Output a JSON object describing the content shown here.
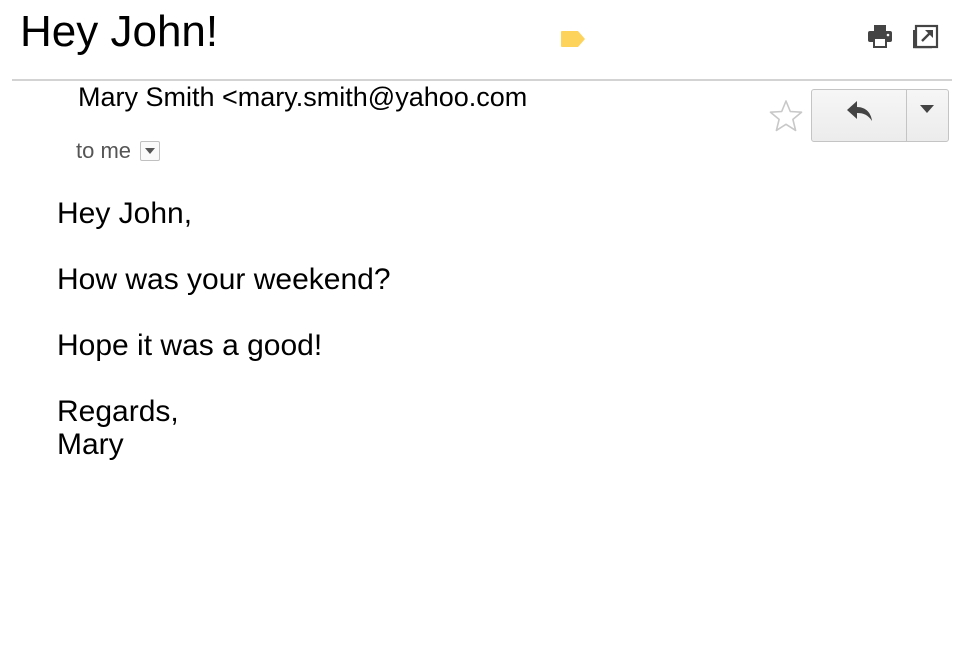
{
  "email": {
    "subject": "Hey John!",
    "sender": "Mary Smith <mary.smith@yahoo.com",
    "recipient": "to me",
    "body": {
      "greeting": "Hey John,",
      "line1": "How was your weekend?",
      "line2": "Hope it was a good!",
      "closing": "Regards,",
      "signature": "Mary"
    }
  },
  "icons": {
    "label": "label-tag-icon",
    "print": "print-icon",
    "new_window": "open-in-new-window-icon",
    "star": "star-outline-icon",
    "reply": "reply-arrow-icon",
    "more": "dropdown-arrow-icon",
    "recipient_details": "details-dropdown-icon"
  },
  "colors": {
    "label_tag": "#fdd35c",
    "icon_dark": "#444444",
    "divider": "#d3d3d3",
    "star_outline": "#c8c8c8"
  }
}
